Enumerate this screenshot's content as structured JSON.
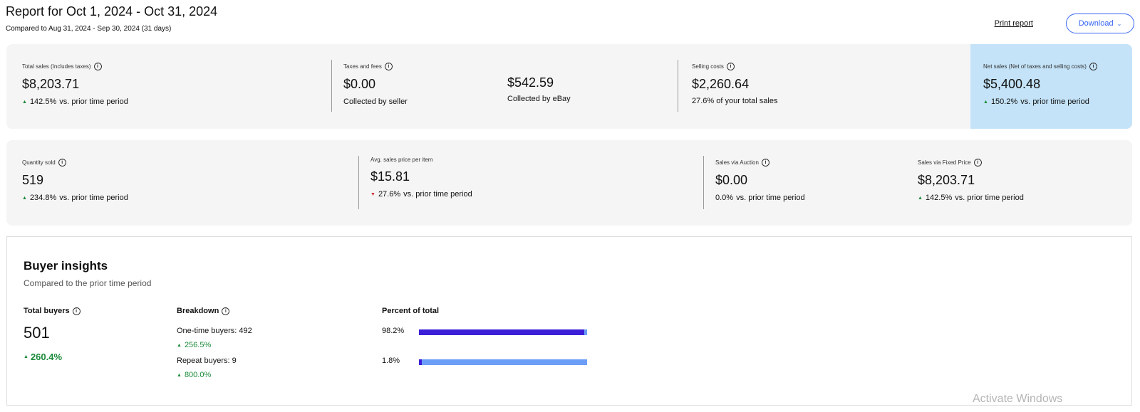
{
  "report": {
    "title": "Report for Oct 1, 2024 - Oct 31, 2024",
    "comparison": "Compared to Aug 31, 2024 - Sep 30, 2024 (31 days)",
    "print_label": "Print report",
    "download_label": "Download"
  },
  "sales_summary": {
    "total_sales": {
      "label": "Total sales (Includes taxes)",
      "value": "$8,203.71",
      "change": "142.5%",
      "change_suffix": "vs. prior time period",
      "direction": "up"
    },
    "taxes_fees": {
      "label": "Taxes and fees",
      "seller_value": "$0.00",
      "seller_caption": "Collected by seller",
      "ebay_value": "$542.59",
      "ebay_caption": "Collected by eBay"
    },
    "selling_costs": {
      "label": "Selling costs",
      "value": "$2,260.64",
      "caption": "27.6% of your total sales"
    },
    "net_sales": {
      "label": "Net sales (Net of taxes and selling costs)",
      "value": "$5,400.48",
      "change": "150.2%",
      "change_suffix": "vs. prior time period",
      "direction": "up"
    }
  },
  "item_summary": {
    "quantity_sold": {
      "label": "Quantity sold",
      "value": "519",
      "change": "234.8%",
      "change_suffix": "vs. prior time period",
      "direction": "up"
    },
    "avg_price": {
      "label": "Avg. sales price per item",
      "value": "$15.81",
      "change": "27.6%",
      "change_suffix": "vs. prior time period",
      "direction": "down"
    },
    "auction": {
      "label": "Sales via Auction",
      "value": "$0.00",
      "change": "0.0%",
      "change_suffix": "vs. prior time period",
      "direction": "none"
    },
    "fixed_price": {
      "label": "Sales via Fixed Price",
      "value": "$8,203.71",
      "change": "142.5%",
      "change_suffix": "vs. prior time period",
      "direction": "up"
    }
  },
  "buyer_insights": {
    "title": "Buyer insights",
    "subtitle": "Compared to the prior time period",
    "total_buyers": {
      "label": "Total buyers",
      "value": "501",
      "change": "260.4%"
    },
    "breakdown": {
      "label": "Breakdown",
      "one_time": {
        "text": "One-time buyers: 492",
        "change": "256.5%"
      },
      "repeat": {
        "text": "Repeat buyers: 9",
        "change": "800.0%"
      }
    },
    "percent": {
      "label": "Percent of total",
      "one_time_pct_text": "98.2%",
      "one_time_fraction": 0.982,
      "repeat_pct_text": "1.8%",
      "repeat_fraction": 0.018
    }
  },
  "colors": {
    "accent": "#3665f3",
    "positive": "#1a8a3a",
    "negative": "#d42b2b",
    "bar_primary": "#3b1fd8",
    "bar_secondary": "#6c9ef8",
    "net_highlight": "#c4e3f8"
  },
  "watermark": "Activate Windows"
}
